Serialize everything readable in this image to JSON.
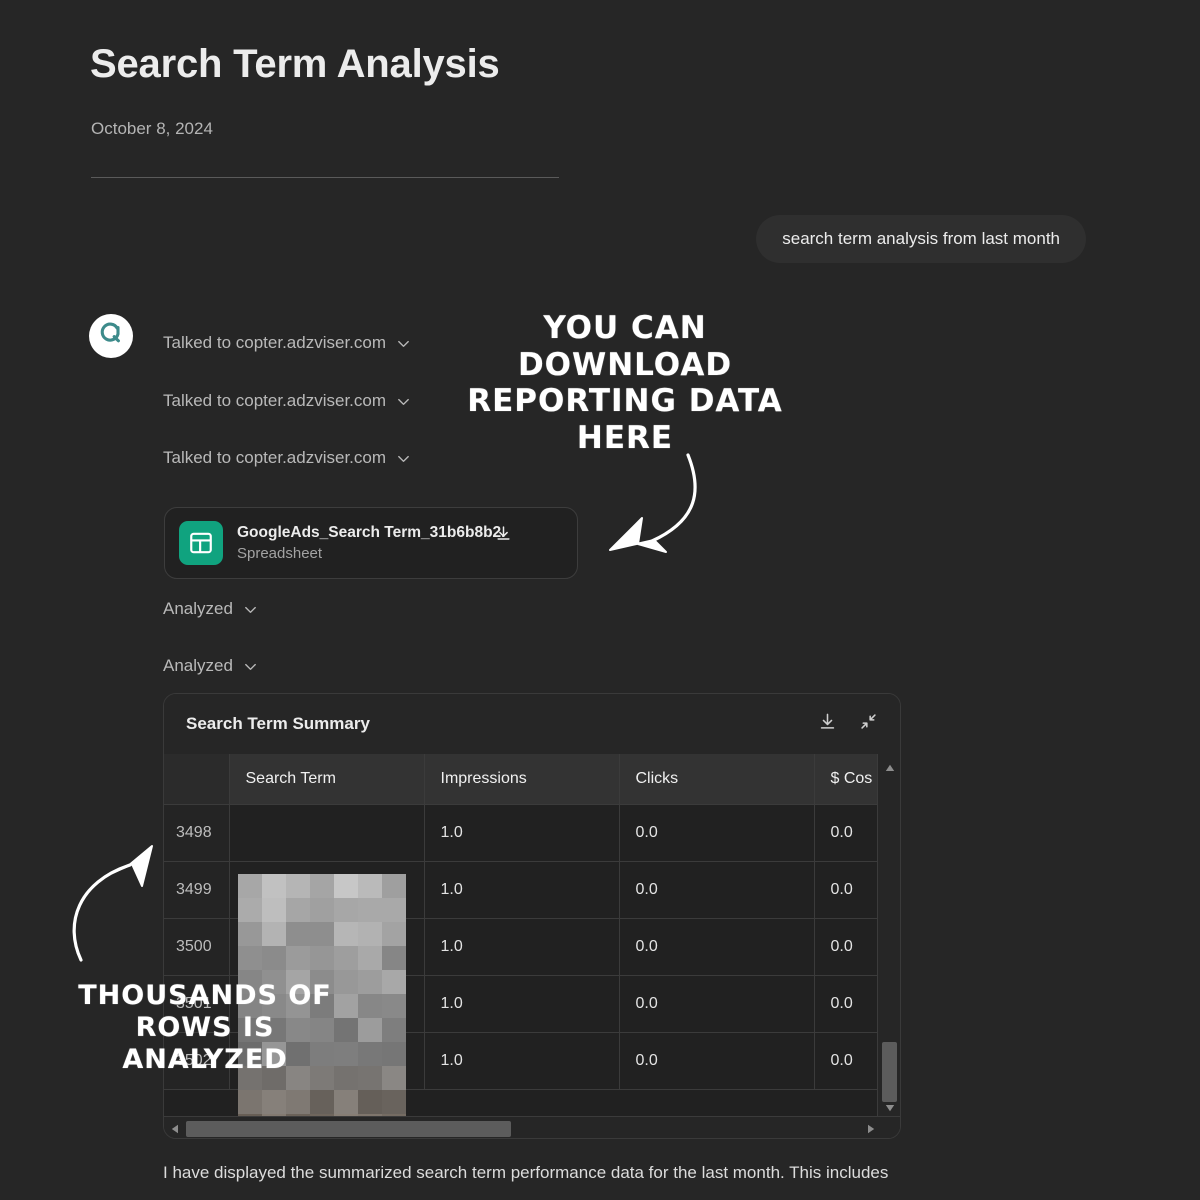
{
  "document": {
    "title": "Search Term Analysis",
    "date": "October 8, 2024"
  },
  "conversation": {
    "user_message": "search term analysis from last month",
    "avatar_icon": "adzviser-logo-icon",
    "tool_calls": [
      {
        "label": "Talked to copter.adzviser.com",
        "chevron": "chevron-down-icon"
      },
      {
        "label": "Talked to copter.adzviser.com",
        "chevron": "chevron-down-icon"
      },
      {
        "label": "Talked to copter.adzviser.com",
        "chevron": "chevron-down-icon"
      }
    ],
    "analysis_steps": [
      {
        "label": "Analyzed",
        "chevron": "chevron-down-icon"
      },
      {
        "label": "Analyzed",
        "chevron": "chevron-down-icon"
      }
    ],
    "attachment": {
      "name": "GoogleAds_Search Term_31b6b8b2.",
      "subtitle": "Spreadsheet",
      "icon": "spreadsheet-icon",
      "download_icon": "download-icon",
      "icon_color": "#10a37f"
    },
    "answer_text": "I have displayed the summarized search term performance data for the last month. This includes"
  },
  "table": {
    "title": "Search Term Summary",
    "actions": [
      {
        "name": "download-icon",
        "label": "Download"
      },
      {
        "name": "collapse-icon",
        "label": "Collapse"
      }
    ],
    "columns": [
      "",
      "Search Term",
      "Impressions",
      "Clicks",
      "$ Cos"
    ],
    "rows": [
      {
        "index": "3498",
        "search_term": "",
        "impressions": "1.0",
        "clicks": "0.0",
        "cost": "0.0"
      },
      {
        "index": "3499",
        "search_term": "",
        "impressions": "1.0",
        "clicks": "0.0",
        "cost": "0.0"
      },
      {
        "index": "3500",
        "search_term": "",
        "impressions": "1.0",
        "clicks": "0.0",
        "cost": "0.0"
      },
      {
        "index": "3501",
        "search_term": "",
        "impressions": "1.0",
        "clicks": "0.0",
        "cost": "0.0"
      },
      {
        "index": "3502",
        "search_term": "",
        "impressions": "1.0",
        "clicks": "0.0",
        "cost": "0.0"
      }
    ],
    "scrollbars": {
      "vertical": "vertical-scrollbar",
      "horizontal": "horizontal-scrollbar"
    }
  },
  "annotations": [
    {
      "id": "download-annotation",
      "lines": [
        "You can download",
        "reporting data",
        "here"
      ],
      "arrow": "curved-arrow-down-left"
    },
    {
      "id": "rows-annotation",
      "lines": [
        "Thousands of",
        "rows is",
        "analyzed"
      ],
      "arrow": "curved-arrow-up-right"
    }
  ],
  "colors": {
    "background": "#262626",
    "card": "#212121",
    "accent_green": "#10a37f",
    "accent_teal": "#3d8b8b",
    "text_primary": "#ececec",
    "text_secondary": "#b4b4b4"
  }
}
